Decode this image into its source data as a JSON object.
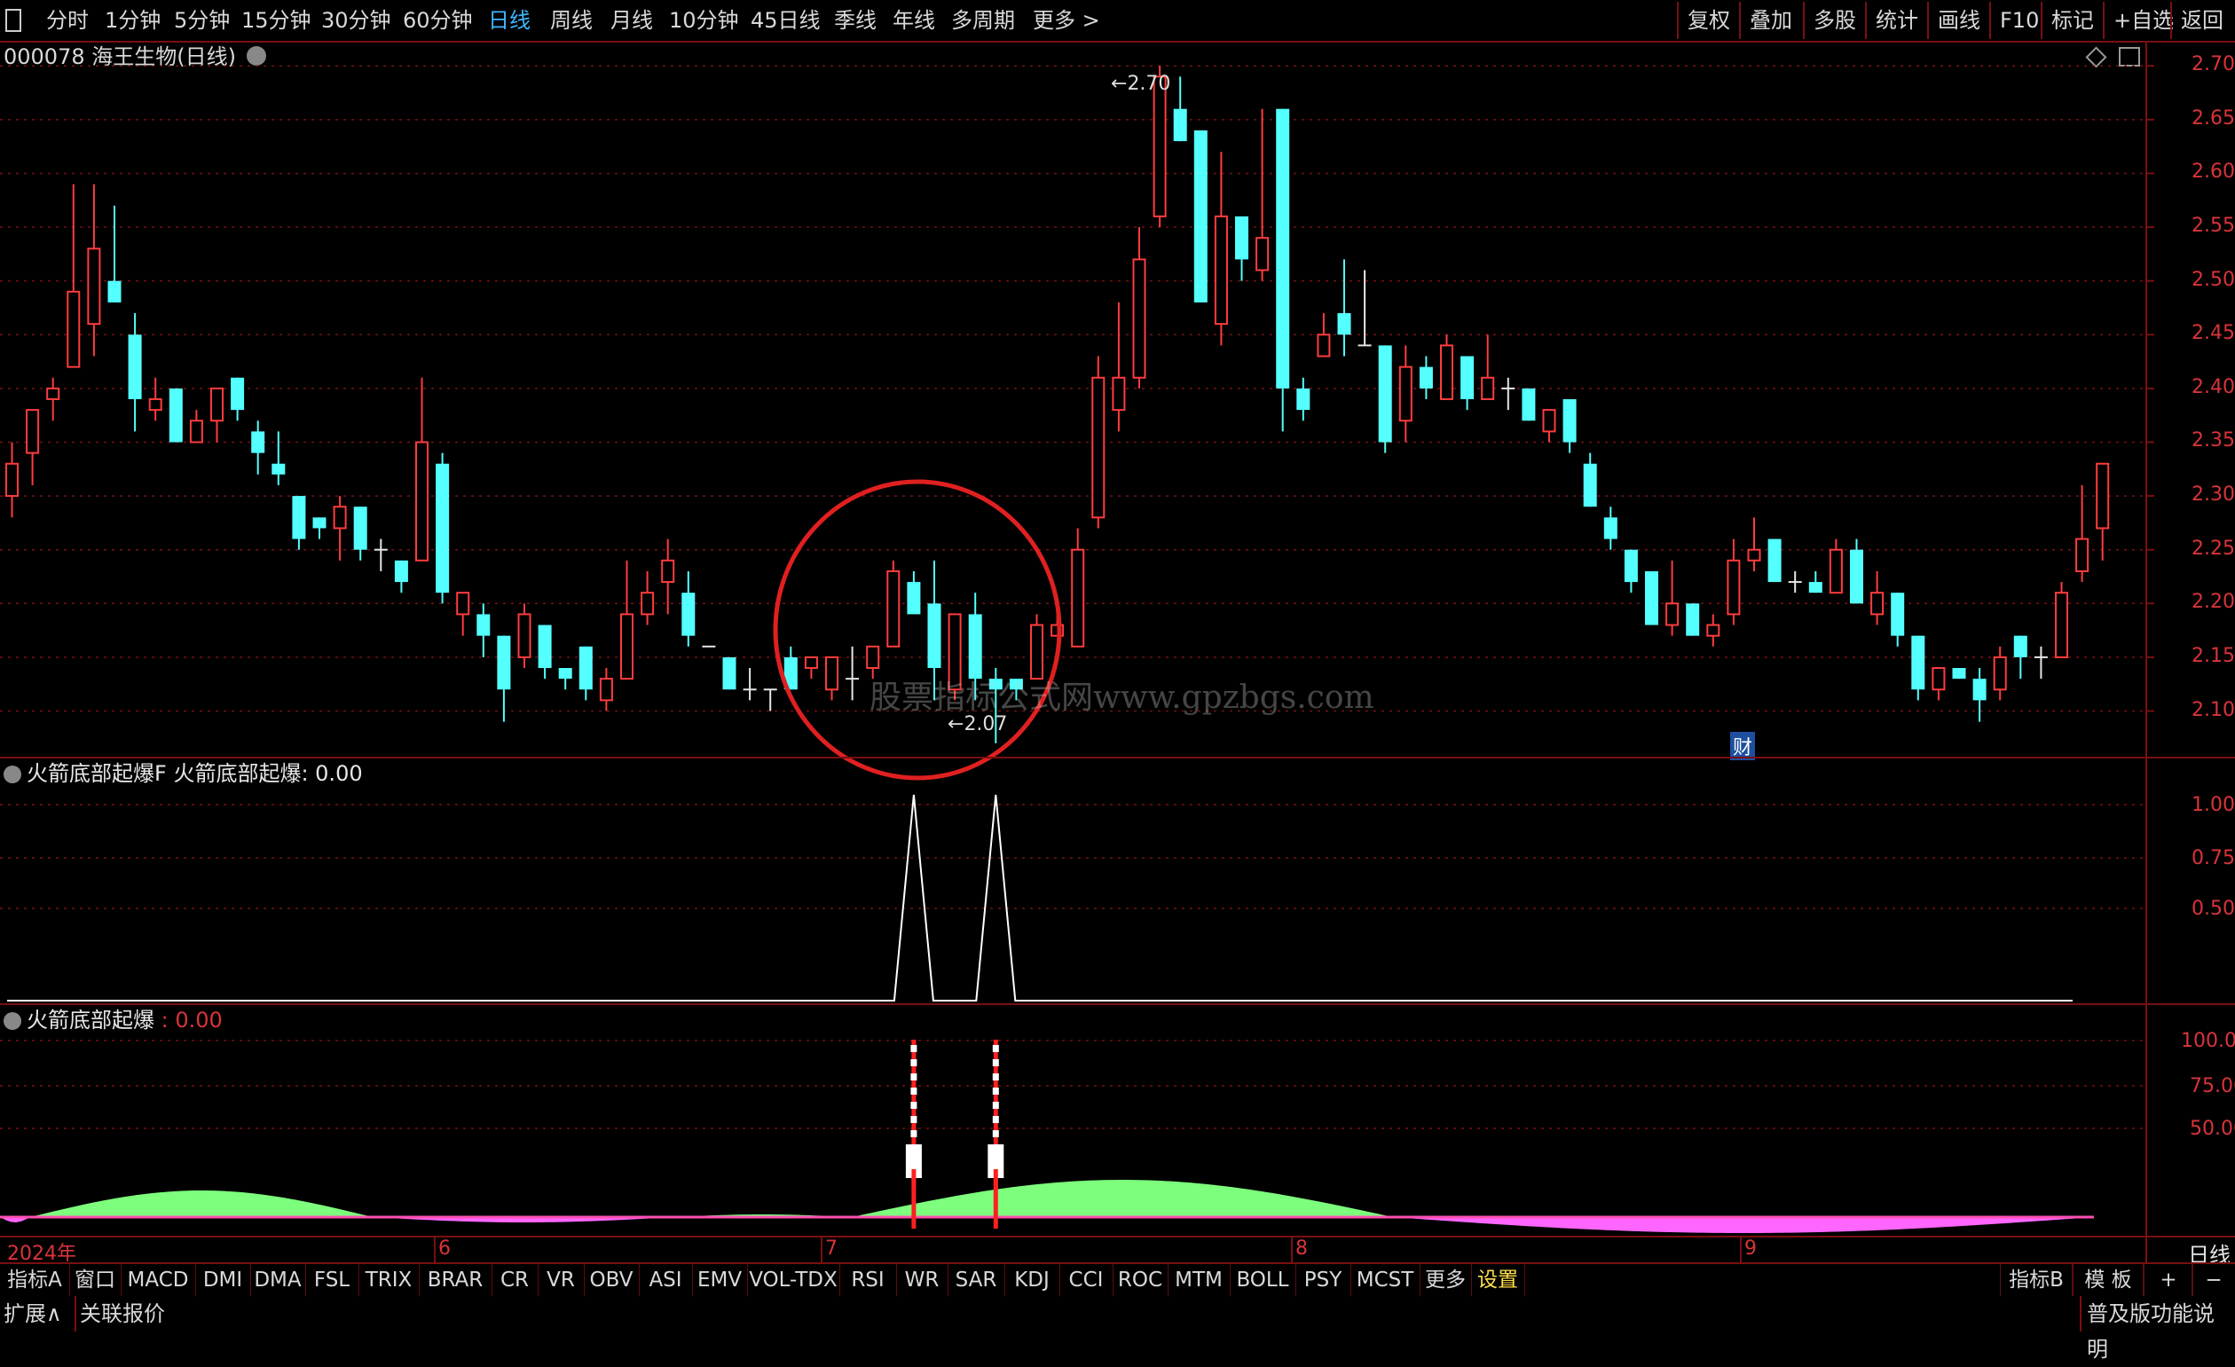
{
  "topbar": {
    "periods": [
      "分时",
      "1分钟",
      "5分钟",
      "15分钟",
      "30分钟",
      "60分钟",
      "日线",
      "周线",
      "月线",
      "10分钟",
      "45日线",
      "季线",
      "年线",
      "多周期",
      "更多 >"
    ],
    "active_period": "日线",
    "right_buttons": [
      "复权",
      "叠加",
      "多股",
      "统计",
      "画线",
      "F10",
      "标记",
      "+自选",
      "返回"
    ]
  },
  "stock": {
    "title": "000078 海王生物(日线)",
    "high_label": "2.70",
    "low_label": "2.07",
    "finance_badge": "财"
  },
  "price_axis": [
    "2.70",
    "2.65",
    "2.60",
    "2.55",
    "2.50",
    "2.45",
    "2.40",
    "2.35",
    "2.30",
    "2.25",
    "2.20",
    "2.15",
    "2.10"
  ],
  "indicator1": {
    "title": "火箭底部起爆F",
    "value_label": "火箭底部起爆: 0.00",
    "axis": [
      "1.00",
      "0.75",
      "0.50"
    ]
  },
  "indicator2": {
    "title": "火箭底部起爆",
    "value_label": ": 0.00",
    "axis": [
      "100.0",
      "75.00",
      "50.00"
    ]
  },
  "date_axis": {
    "year": "2024年",
    "months": [
      "6",
      "7",
      "8",
      "9"
    ],
    "period_label": "日线"
  },
  "watermark": "股票指标公式网www.gpzbgs.com",
  "bottom_tabs": [
    "指标A",
    "窗口",
    "MACD",
    "DMI",
    "DMA",
    "FSL",
    "TRIX",
    "BRAR",
    "CR",
    "VR",
    "OBV",
    "ASI",
    "EMV",
    "VOL-TDX",
    "RSI",
    "WR",
    "SAR",
    "KDJ",
    "CCI",
    "ROC",
    "MTM",
    "BOLL",
    "PSY",
    "MCST",
    "更多",
    "设置"
  ],
  "bottom_right": [
    "指标B",
    "模 板",
    "+",
    "−"
  ],
  "status": {
    "left1": "扩展∧",
    "left2": "关联报价",
    "right": "普及版功能说明"
  },
  "colors": {
    "up": "#ff3c3c",
    "down": "#54ffff",
    "grid": "#7a0f12",
    "accent": "#3fb7ff",
    "circle": "#e02020"
  },
  "chart_data": {
    "type": "candlestick",
    "ylim": [
      2.06,
      2.72
    ],
    "candles": [
      [
        2.3,
        2.35,
        2.28,
        2.33
      ],
      [
        2.34,
        2.38,
        2.31,
        2.38
      ],
      [
        2.39,
        2.41,
        2.37,
        2.4
      ],
      [
        2.42,
        2.59,
        2.42,
        2.49
      ],
      [
        2.46,
        2.59,
        2.43,
        2.53
      ],
      [
        2.5,
        2.57,
        2.48,
        2.48
      ],
      [
        2.45,
        2.47,
        2.36,
        2.39
      ],
      [
        2.38,
        2.41,
        2.37,
        2.39
      ],
      [
        2.4,
        2.4,
        2.35,
        2.35
      ],
      [
        2.35,
        2.38,
        2.35,
        2.37
      ],
      [
        2.37,
        2.4,
        2.35,
        2.4
      ],
      [
        2.41,
        2.41,
        2.37,
        2.38
      ],
      [
        2.36,
        2.37,
        2.32,
        2.34
      ],
      [
        2.33,
        2.36,
        2.31,
        2.32
      ],
      [
        2.3,
        2.3,
        2.25,
        2.26
      ],
      [
        2.28,
        2.28,
        2.26,
        2.27
      ],
      [
        2.27,
        2.3,
        2.24,
        2.29
      ],
      [
        2.29,
        2.29,
        2.24,
        2.25
      ],
      [
        2.25,
        2.26,
        2.23,
        2.25
      ],
      [
        2.24,
        2.24,
        2.21,
        2.22
      ],
      [
        2.24,
        2.41,
        2.24,
        2.35
      ],
      [
        2.33,
        2.34,
        2.2,
        2.21
      ],
      [
        2.19,
        2.21,
        2.17,
        2.21
      ],
      [
        2.19,
        2.2,
        2.15,
        2.17
      ],
      [
        2.17,
        2.17,
        2.09,
        2.12
      ],
      [
        2.15,
        2.2,
        2.14,
        2.19
      ],
      [
        2.18,
        2.18,
        2.13,
        2.14
      ],
      [
        2.14,
        2.14,
        2.12,
        2.13
      ],
      [
        2.16,
        2.16,
        2.11,
        2.12
      ],
      [
        2.11,
        2.14,
        2.1,
        2.13
      ],
      [
        2.13,
        2.24,
        2.13,
        2.19
      ],
      [
        2.19,
        2.23,
        2.18,
        2.21
      ],
      [
        2.22,
        2.26,
        2.19,
        2.24
      ],
      [
        2.21,
        2.23,
        2.16,
        2.17
      ],
      [
        2.16,
        2.16,
        2.16,
        2.16
      ],
      [
        2.15,
        2.15,
        2.12,
        2.12
      ],
      [
        2.12,
        2.14,
        2.11,
        2.12
      ],
      [
        2.12,
        2.12,
        2.1,
        2.12
      ],
      [
        2.15,
        2.16,
        2.12,
        2.12
      ],
      [
        2.14,
        2.15,
        2.13,
        2.15
      ],
      [
        2.12,
        2.15,
        2.11,
        2.15
      ],
      [
        2.13,
        2.16,
        2.11,
        2.13
      ],
      [
        2.14,
        2.16,
        2.13,
        2.16
      ],
      [
        2.16,
        2.24,
        2.16,
        2.23
      ],
      [
        2.22,
        2.23,
        2.19,
        2.19
      ],
      [
        2.2,
        2.24,
        2.11,
        2.14
      ],
      [
        2.12,
        2.19,
        2.11,
        2.19
      ],
      [
        2.19,
        2.21,
        2.11,
        2.13
      ],
      [
        2.13,
        2.14,
        2.07,
        2.12
      ],
      [
        2.13,
        2.13,
        2.11,
        2.12
      ],
      [
        2.13,
        2.19,
        2.13,
        2.18
      ],
      [
        2.17,
        2.19,
        2.17,
        2.18
      ],
      [
        2.16,
        2.27,
        2.16,
        2.25
      ],
      [
        2.28,
        2.43,
        2.27,
        2.41
      ],
      [
        2.38,
        2.48,
        2.36,
        2.41
      ],
      [
        2.41,
        2.55,
        2.4,
        2.52
      ],
      [
        2.56,
        2.7,
        2.55,
        2.69
      ],
      [
        2.66,
        2.69,
        2.63,
        2.63
      ],
      [
        2.64,
        2.64,
        2.48,
        2.48
      ],
      [
        2.46,
        2.62,
        2.44,
        2.56
      ],
      [
        2.56,
        2.56,
        2.5,
        2.52
      ],
      [
        2.51,
        2.66,
        2.5,
        2.54
      ],
      [
        2.66,
        2.66,
        2.36,
        2.4
      ],
      [
        2.4,
        2.41,
        2.37,
        2.38
      ],
      [
        2.43,
        2.47,
        2.43,
        2.45
      ],
      [
        2.47,
        2.52,
        2.43,
        2.45
      ],
      [
        2.44,
        2.51,
        2.44,
        2.44
      ],
      [
        2.44,
        2.44,
        2.34,
        2.35
      ],
      [
        2.37,
        2.44,
        2.35,
        2.42
      ],
      [
        2.42,
        2.43,
        2.39,
        2.4
      ],
      [
        2.39,
        2.45,
        2.39,
        2.44
      ],
      [
        2.43,
        2.43,
        2.38,
        2.39
      ],
      [
        2.39,
        2.45,
        2.39,
        2.41
      ],
      [
        2.4,
        2.41,
        2.38,
        2.4
      ],
      [
        2.4,
        2.4,
        2.37,
        2.37
      ],
      [
        2.36,
        2.38,
        2.35,
        2.38
      ],
      [
        2.39,
        2.39,
        2.34,
        2.35
      ],
      [
        2.33,
        2.34,
        2.29,
        2.29
      ],
      [
        2.28,
        2.29,
        2.25,
        2.26
      ],
      [
        2.25,
        2.25,
        2.21,
        2.22
      ],
      [
        2.23,
        2.23,
        2.18,
        2.18
      ],
      [
        2.18,
        2.24,
        2.17,
        2.2
      ],
      [
        2.2,
        2.2,
        2.17,
        2.17
      ],
      [
        2.17,
        2.19,
        2.16,
        2.18
      ],
      [
        2.19,
        2.26,
        2.18,
        2.24
      ],
      [
        2.24,
        2.28,
        2.23,
        2.25
      ],
      [
        2.26,
        2.26,
        2.22,
        2.22
      ],
      [
        2.22,
        2.23,
        2.21,
        2.22
      ],
      [
        2.22,
        2.23,
        2.21,
        2.21
      ],
      [
        2.21,
        2.26,
        2.21,
        2.25
      ],
      [
        2.25,
        2.26,
        2.2,
        2.2
      ],
      [
        2.19,
        2.23,
        2.18,
        2.21
      ],
      [
        2.21,
        2.21,
        2.16,
        2.17
      ],
      [
        2.17,
        2.17,
        2.11,
        2.12
      ],
      [
        2.12,
        2.14,
        2.11,
        2.14
      ],
      [
        2.14,
        2.14,
        2.13,
        2.13
      ],
      [
        2.13,
        2.14,
        2.09,
        2.11
      ],
      [
        2.12,
        2.16,
        2.11,
        2.15
      ],
      [
        2.17,
        2.17,
        2.13,
        2.15
      ],
      [
        2.15,
        2.16,
        2.13,
        2.15
      ],
      [
        2.15,
        2.22,
        2.15,
        2.21
      ],
      [
        2.23,
        2.31,
        2.22,
        2.26
      ],
      [
        2.27,
        2.33,
        2.24,
        2.33
      ]
    ],
    "signal_candle_indices": [
      44,
      48
    ],
    "indicator1_series": {
      "name": "火箭底部起爆",
      "values_at_signals": [
        1.0,
        1.0
      ],
      "baseline": 0.0
    }
  }
}
